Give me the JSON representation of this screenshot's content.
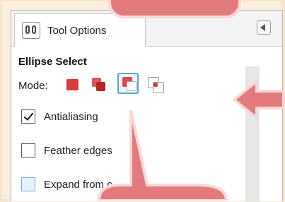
{
  "panel": {
    "tab_label": "Tool Options",
    "tool_icon": "tool-options-icon",
    "dock_menu_icon": "triangle-left-icon"
  },
  "tool": {
    "title": "Ellipse Select",
    "mode_label": "Mode:",
    "modes": [
      {
        "name": "replace",
        "icon": "mode-replace-icon"
      },
      {
        "name": "add",
        "icon": "mode-add-icon"
      },
      {
        "name": "subtract",
        "icon": "mode-subtract-icon",
        "selected": true
      },
      {
        "name": "intersect",
        "icon": "mode-intersect-icon"
      }
    ],
    "options": [
      {
        "label": "Antialiasing",
        "checked": true
      },
      {
        "label": "Feather edges",
        "checked": false
      },
      {
        "label": "Expand from c",
        "checked": false
      }
    ]
  },
  "annotations": {
    "callout_color": "#e37b7e",
    "callout_border": "#f7d8d6"
  }
}
